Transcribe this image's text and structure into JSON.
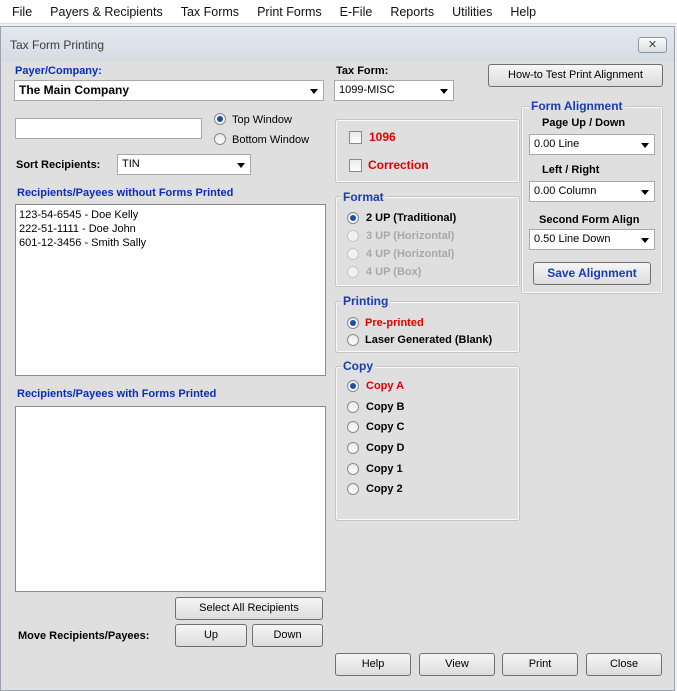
{
  "menu": [
    "File",
    "Payers & Recipients",
    "Tax Forms",
    "Print Forms",
    "E-File",
    "Reports",
    "Utilities",
    "Help"
  ],
  "window": {
    "title": "Tax Form Printing",
    "close_glyph": "✕"
  },
  "payer": {
    "label": "Payer/Company:",
    "value": "The Main Company"
  },
  "tax_form": {
    "label": "Tax Form:",
    "value": "1099-MISC"
  },
  "howto_button": "How-to Test Print  Alignment",
  "search_value": "",
  "window_options": {
    "top": "Top Window",
    "bottom": "Bottom Window"
  },
  "sort": {
    "label": "Sort Recipients:",
    "value": "TIN"
  },
  "without": {
    "label": "Recipients/Payees without Forms Printed",
    "items": [
      "123-54-6545 - Doe  Kelly",
      "222-51-1111 - Doe  John",
      "601-12-3456 - Smith  Sally"
    ]
  },
  "with": {
    "label": "Recipients/Payees with Forms Printed",
    "items": []
  },
  "select_all_button": "Select All Recipients",
  "move": {
    "label": "Move Recipients/Payees:",
    "up": "Up",
    "down": "Down"
  },
  "checks": {
    "c1096": "1096",
    "correction": "Correction"
  },
  "format": {
    "title": "Format",
    "options": [
      "2 UP (Traditional)",
      "3 UP (Horizontal)",
      "4 UP (Horizontal)",
      "4 UP (Box)"
    ]
  },
  "printing": {
    "title": "Printing",
    "options": [
      "Pre-printed",
      "Laser Generated (Blank)"
    ]
  },
  "copy": {
    "title": "Copy",
    "options": [
      "Copy A",
      "Copy B",
      "Copy C",
      "Copy D",
      "Copy 1",
      "Copy 2"
    ]
  },
  "alignment": {
    "title": "Form Alignment",
    "page_label": "Page Up / Down",
    "page_value": "0.00 Line",
    "lr_label": "Left / Right",
    "lr_value": "0.00 Column",
    "second_label": "Second Form Align",
    "second_value": "0.50 Line Down",
    "save": "Save  Alignment"
  },
  "footer": {
    "help": "Help",
    "view": "View",
    "print": "Print",
    "close": "Close"
  }
}
